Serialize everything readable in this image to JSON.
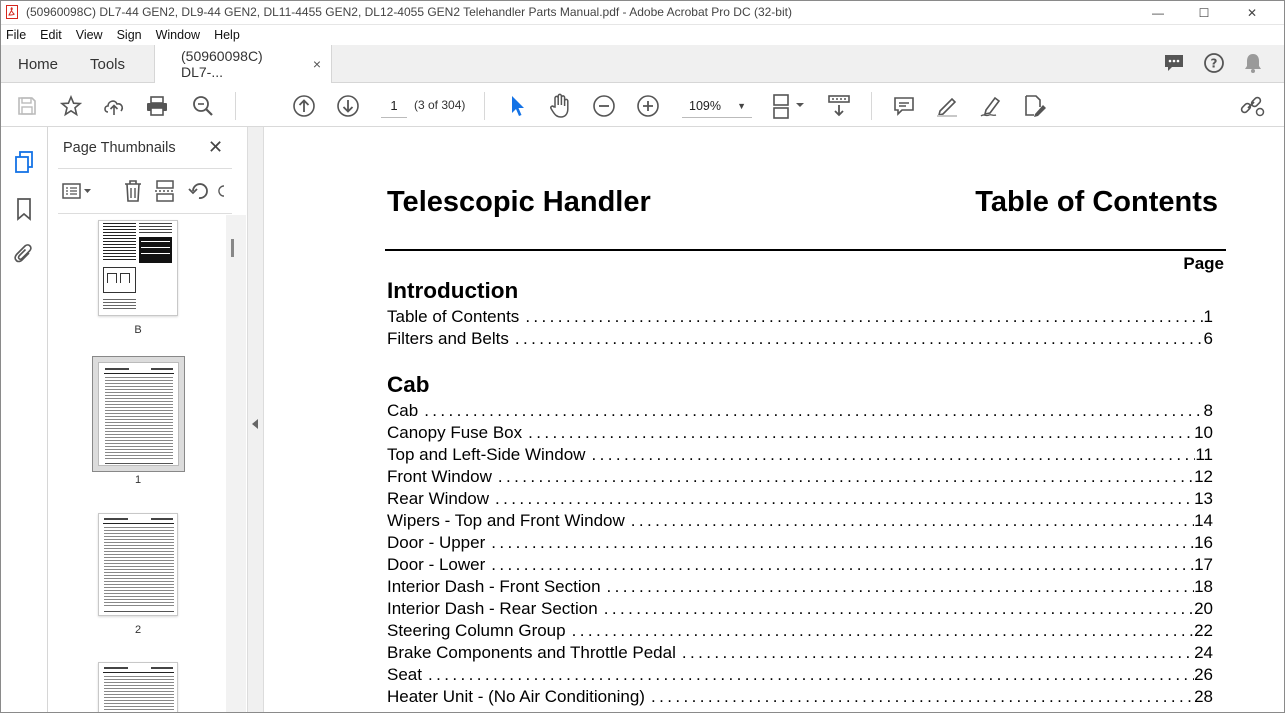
{
  "window": {
    "title": "(50960098C) DL7-44 GEN2, DL9-44 GEN2, DL11-4455 GEN2, DL12-4055 GEN2 Telehandler Parts Manual.pdf - Adobe Acrobat Pro DC (32-bit)",
    "minimize": "—",
    "maximize": "☐",
    "close": "✕"
  },
  "menu": [
    "File",
    "Edit",
    "View",
    "Sign",
    "Window",
    "Help"
  ],
  "tabs": {
    "home": "Home",
    "tools": "Tools",
    "document": "(50960098C) DL7-...",
    "document_close": "×"
  },
  "toolbar": {
    "page_number": "1",
    "page_count": "(3 of 304)",
    "zoom": "109%"
  },
  "thumbnails_panel": {
    "title": "Page Thumbnails",
    "close": "✕",
    "pages": [
      {
        "label": "B"
      },
      {
        "label": "1",
        "selected": true
      },
      {
        "label": "2"
      }
    ]
  },
  "document": {
    "left_title": "Telescopic Handler",
    "right_title": "Table of Contents",
    "page_header": "Page",
    "sections": [
      {
        "heading": "Introduction",
        "entries": [
          {
            "label": "Table of Contents",
            "page": "1"
          },
          {
            "label": "Filters and Belts",
            "page": "6"
          }
        ]
      },
      {
        "heading": "Cab",
        "entries": [
          {
            "label": "Cab",
            "page": "8"
          },
          {
            "label": "Canopy Fuse Box",
            "page": "10"
          },
          {
            "label": "Top and Left-Side Window",
            "page": "11"
          },
          {
            "label": "Front Window",
            "page": "12"
          },
          {
            "label": "Rear Window",
            "page": "13"
          },
          {
            "label": "Wipers - Top and Front Window",
            "page": "14"
          },
          {
            "label": "Door - Upper",
            "page": "16"
          },
          {
            "label": "Door - Lower",
            "page": "17"
          },
          {
            "label": "Interior Dash - Front Section",
            "page": "18"
          },
          {
            "label": "Interior Dash - Rear Section",
            "page": "20"
          },
          {
            "label": "Steering Column Group",
            "page": "22"
          },
          {
            "label": "Brake Components and Throttle Pedal",
            "page": "24"
          },
          {
            "label": "Seat",
            "page": "26"
          },
          {
            "label": "Heater Unit - (No Air Conditioning)",
            "page": "28"
          }
        ]
      }
    ]
  },
  "colors": {
    "accent": "#1473e6",
    "icon": "#555555",
    "acrobat_red": "#d6261c"
  }
}
